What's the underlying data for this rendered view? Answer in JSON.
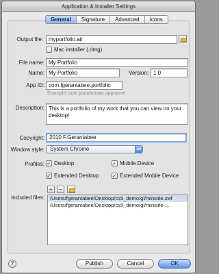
{
  "window": {
    "title": "Application & Installer Settings"
  },
  "tabs": [
    "General",
    "Signature",
    "Advanced",
    "Icons"
  ],
  "form": {
    "output_file": {
      "label": "Output file:",
      "value": "myportfolio.air"
    },
    "mac_installer": {
      "label": "Mac installer (.dmg)",
      "checked": false
    },
    "file_name": {
      "label": "File name:",
      "value": "My Portfolio"
    },
    "name": {
      "label": "Name:",
      "value": "My Portfolio"
    },
    "version": {
      "label": "Version:",
      "value": "1.0"
    },
    "app_id": {
      "label": "App ID:",
      "value": "com.fgerantabee.portfolio",
      "hint": "Example: com.yourdomain.appname"
    },
    "description": {
      "label": "Description:",
      "value": "This is a portfolio of my work that you can view on your desktop!"
    },
    "copyright": {
      "label": "Copyright:",
      "value": "2010 F.Gerantabee"
    },
    "window_style": {
      "label": "Window style:",
      "value": "System Chrome"
    },
    "profiles": {
      "label": "Profiles:",
      "desktop": {
        "label": "Desktop",
        "checked": true
      },
      "mobile_device": {
        "label": "Mobile Device",
        "checked": true
      },
      "extended_desktop": {
        "label": "Extended Desktop",
        "checked": true
      },
      "extended_mobile_device": {
        "label": "Extended Mobile Device",
        "checked": true
      }
    },
    "included_files": {
      "label": "Included files:",
      "items": [
        "/Users/fgerantabee/Desktop/cs5_demo/gl/minisite.swf",
        "/Users/fgerantabee/Desktop/cs5_demo/gl/minisite-..."
      ]
    }
  },
  "buttons": {
    "publish": "Publish",
    "cancel": "Cancel",
    "ok": "OK",
    "help": "?"
  },
  "glyphs": {
    "check": "✓",
    "plus": "+",
    "minus": "−",
    "updown": "▴▾"
  },
  "colors": {
    "accent": "#5c93e4",
    "active_field": "#7aa7e6"
  }
}
